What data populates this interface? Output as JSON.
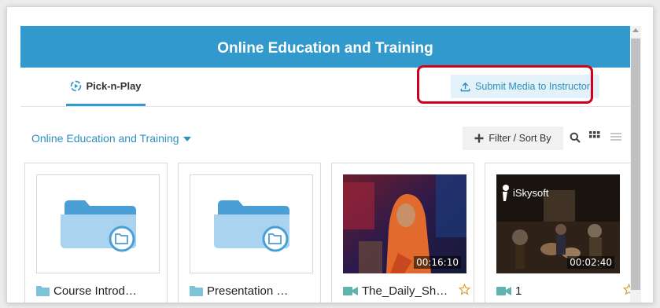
{
  "header": {
    "title": "Online Education and Training"
  },
  "tabs": [
    {
      "label": "Pick-n-Play",
      "icon": "pick-n-play-icon",
      "active": true
    }
  ],
  "submit_button": {
    "label": "Submit Media to Instructor",
    "icon": "upload-icon"
  },
  "breadcrumb": {
    "label": "Online Education and Training",
    "icon": "chevron-down-icon"
  },
  "toolbar": {
    "filter_label": "Filter / Sort By",
    "filter_icon": "plus-icon",
    "search_icon": "search-icon",
    "grid_icon": "grid-view-icon",
    "list_icon": "list-view-icon"
  },
  "media": [
    {
      "title": "Course Introd…",
      "type": "folder"
    },
    {
      "title": "Presentation …",
      "type": "folder"
    },
    {
      "title": "The_Daily_Sh…",
      "type": "video",
      "duration": "00:16:10"
    },
    {
      "title": "1",
      "type": "video",
      "duration": "00:02:40",
      "overlay_text": "iSkysoft"
    }
  ],
  "colors": {
    "brand": "#3299cc",
    "link": "#2f8fc0",
    "highlight": "#d0021b",
    "folder": "#4a9fd6",
    "video_icon": "#5fb4ad"
  }
}
